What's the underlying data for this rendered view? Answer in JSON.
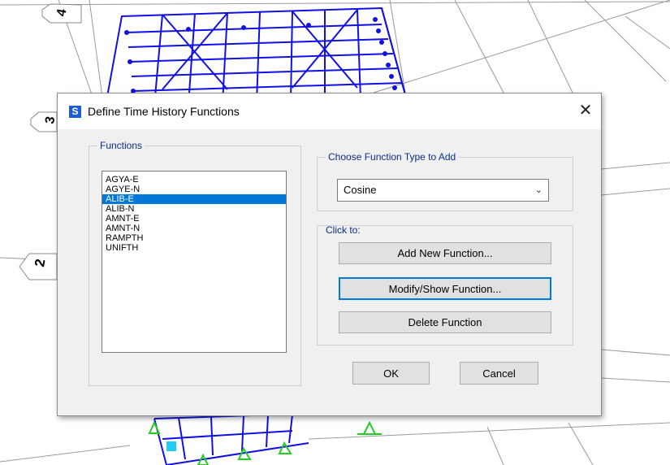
{
  "dialog": {
    "app_icon_letter": "S",
    "title": "Define Time History Functions",
    "close_glyph": "✕"
  },
  "functions_group": {
    "label": "Functions",
    "items": [
      {
        "label": "AGYA-E",
        "selected": false
      },
      {
        "label": "AGYE-N",
        "selected": false
      },
      {
        "label": "ALIB-E",
        "selected": true
      },
      {
        "label": "ALIB-N",
        "selected": false
      },
      {
        "label": "AMNT-E",
        "selected": false
      },
      {
        "label": "AMNT-N",
        "selected": false
      },
      {
        "label": "RAMPTH",
        "selected": false
      },
      {
        "label": "UNIFTH",
        "selected": false
      }
    ]
  },
  "type_group": {
    "label": "Choose  Function Type to Add",
    "selected_type": "Cosine",
    "dropdown_icon": "chevron-down-icon"
  },
  "click_group": {
    "label": "Click to:",
    "add_label": "Add New Function...",
    "modify_label": "Modify/Show Function...",
    "delete_label": "Delete Function"
  },
  "footer": {
    "ok_label": "OK",
    "cancel_label": "Cancel"
  },
  "background": {
    "grid_labels": [
      "4",
      "3",
      "2"
    ]
  },
  "colors": {
    "accent": "#0078d7",
    "group_label": "#0b2d8c",
    "structure_frame": "#1010e6",
    "support_green": "#22cc22"
  }
}
